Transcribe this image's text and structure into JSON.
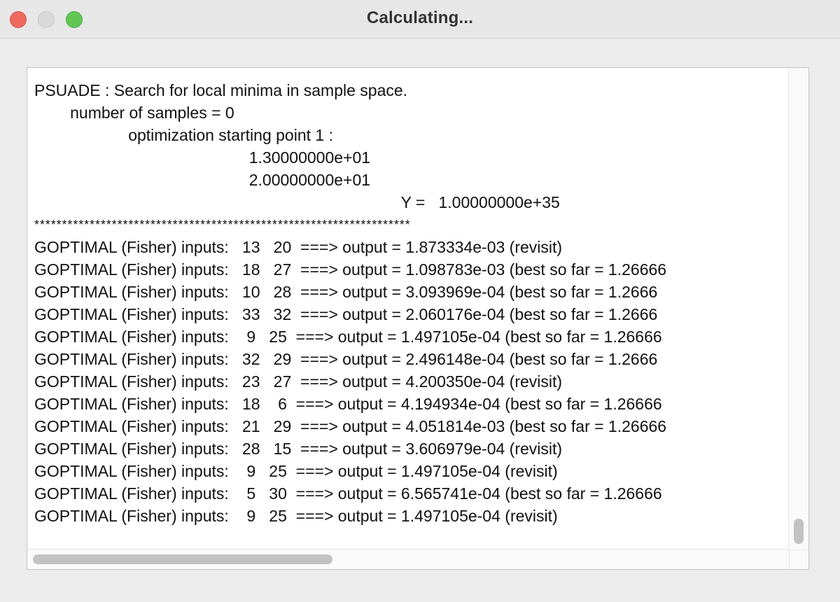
{
  "window": {
    "title": "Calculating..."
  },
  "output": {
    "lines": [
      "PSUADE : Search for local minima in sample space.",
      "        number of samples = 0",
      "                     optimization starting point 1 :",
      "                                                1.30000000e+01",
      "                                                2.00000000e+01",
      "                                                                                  Y =   1.00000000e+35",
      "********************************************************************",
      "GOPTIMAL (Fisher) inputs:   13   20  ===> output = 1.873334e-03 (revisit)",
      "GOPTIMAL (Fisher) inputs:   18   27  ===> output = 1.098783e-03 (best so far = 1.26666",
      "GOPTIMAL (Fisher) inputs:   10   28  ===> output = 3.093969e-04 (best so far = 1.2666",
      "GOPTIMAL (Fisher) inputs:   33   32  ===> output = 2.060176e-04 (best so far = 1.2666",
      "GOPTIMAL (Fisher) inputs:    9   25  ===> output = 1.497105e-04 (best so far = 1.26666",
      "GOPTIMAL (Fisher) inputs:   32   29  ===> output = 2.496148e-04 (best so far = 1.2666",
      "GOPTIMAL (Fisher) inputs:   23   27  ===> output = 4.200350e-04 (revisit)",
      "GOPTIMAL (Fisher) inputs:   18    6  ===> output = 4.194934e-04 (best so far = 1.26666",
      "GOPTIMAL (Fisher) inputs:   21   29  ===> output = 4.051814e-03 (best so far = 1.26666",
      "GOPTIMAL (Fisher) inputs:   28   15  ===> output = 3.606979e-04 (revisit)",
      "GOPTIMAL (Fisher) inputs:    9   25  ===> output = 1.497105e-04 (revisit)",
      "GOPTIMAL (Fisher) inputs:    5   30  ===> output = 6.565741e-04 (best so far = 1.26666",
      "GOPTIMAL (Fisher) inputs:    9   25  ===> output = 1.497105e-04 (revisit)"
    ]
  }
}
